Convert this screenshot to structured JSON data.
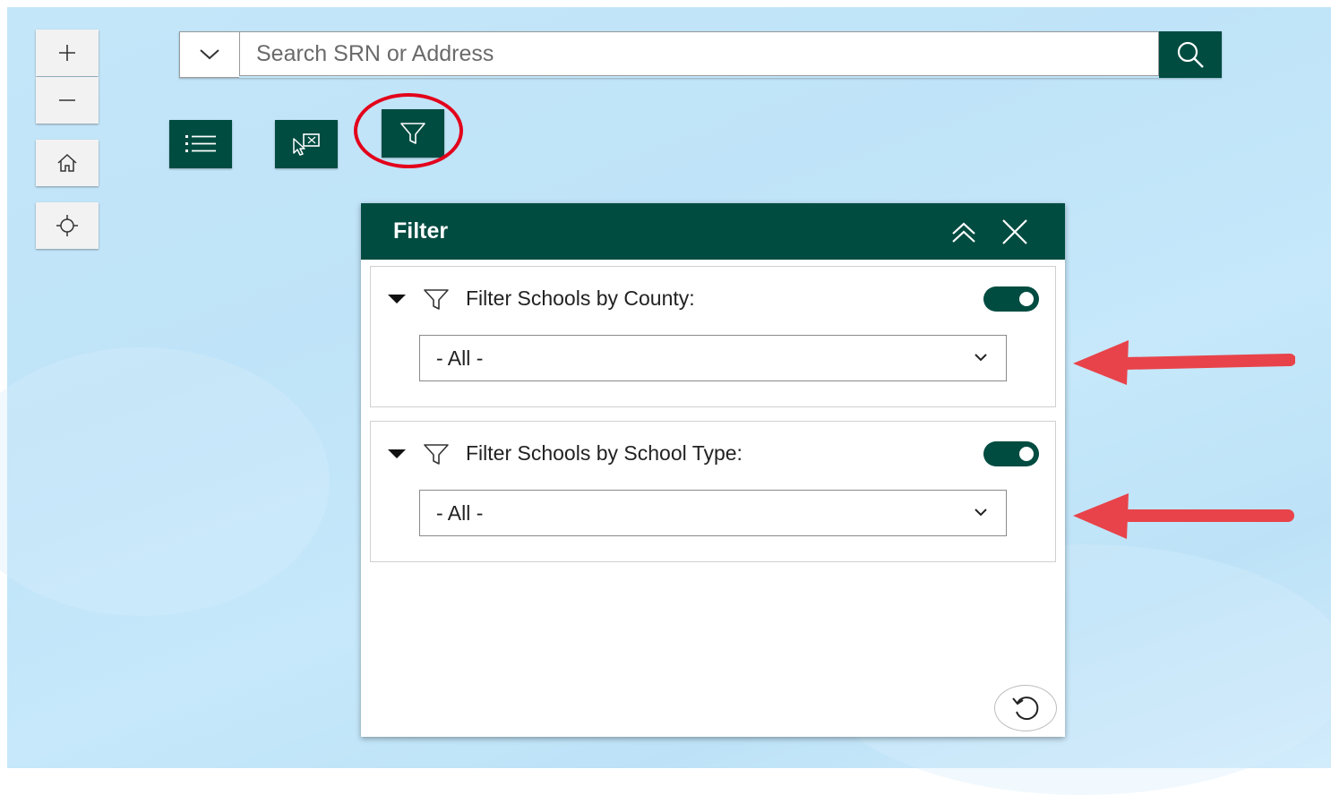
{
  "map_tools": {
    "zoom_in_icon": "plus-icon",
    "zoom_out_icon": "minus-icon",
    "home_icon": "home-icon",
    "locate_icon": "crosshair-icon"
  },
  "search": {
    "placeholder": "Search SRN or Address",
    "value": ""
  },
  "toolbar": {
    "buttons": [
      "list-icon",
      "select-icon",
      "filter-icon"
    ],
    "active": "filter-icon",
    "highlight_color": "#e3001b"
  },
  "panel": {
    "title": "Filter",
    "header_color": "#004c41",
    "filters": [
      {
        "label": "Filter Schools by County:",
        "enabled": true,
        "selected": "- All -"
      },
      {
        "label": "Filter Schools by School Type:",
        "enabled": true,
        "selected": "- All -"
      }
    ]
  },
  "annotations": {
    "arrow_color": "#e8434a"
  }
}
